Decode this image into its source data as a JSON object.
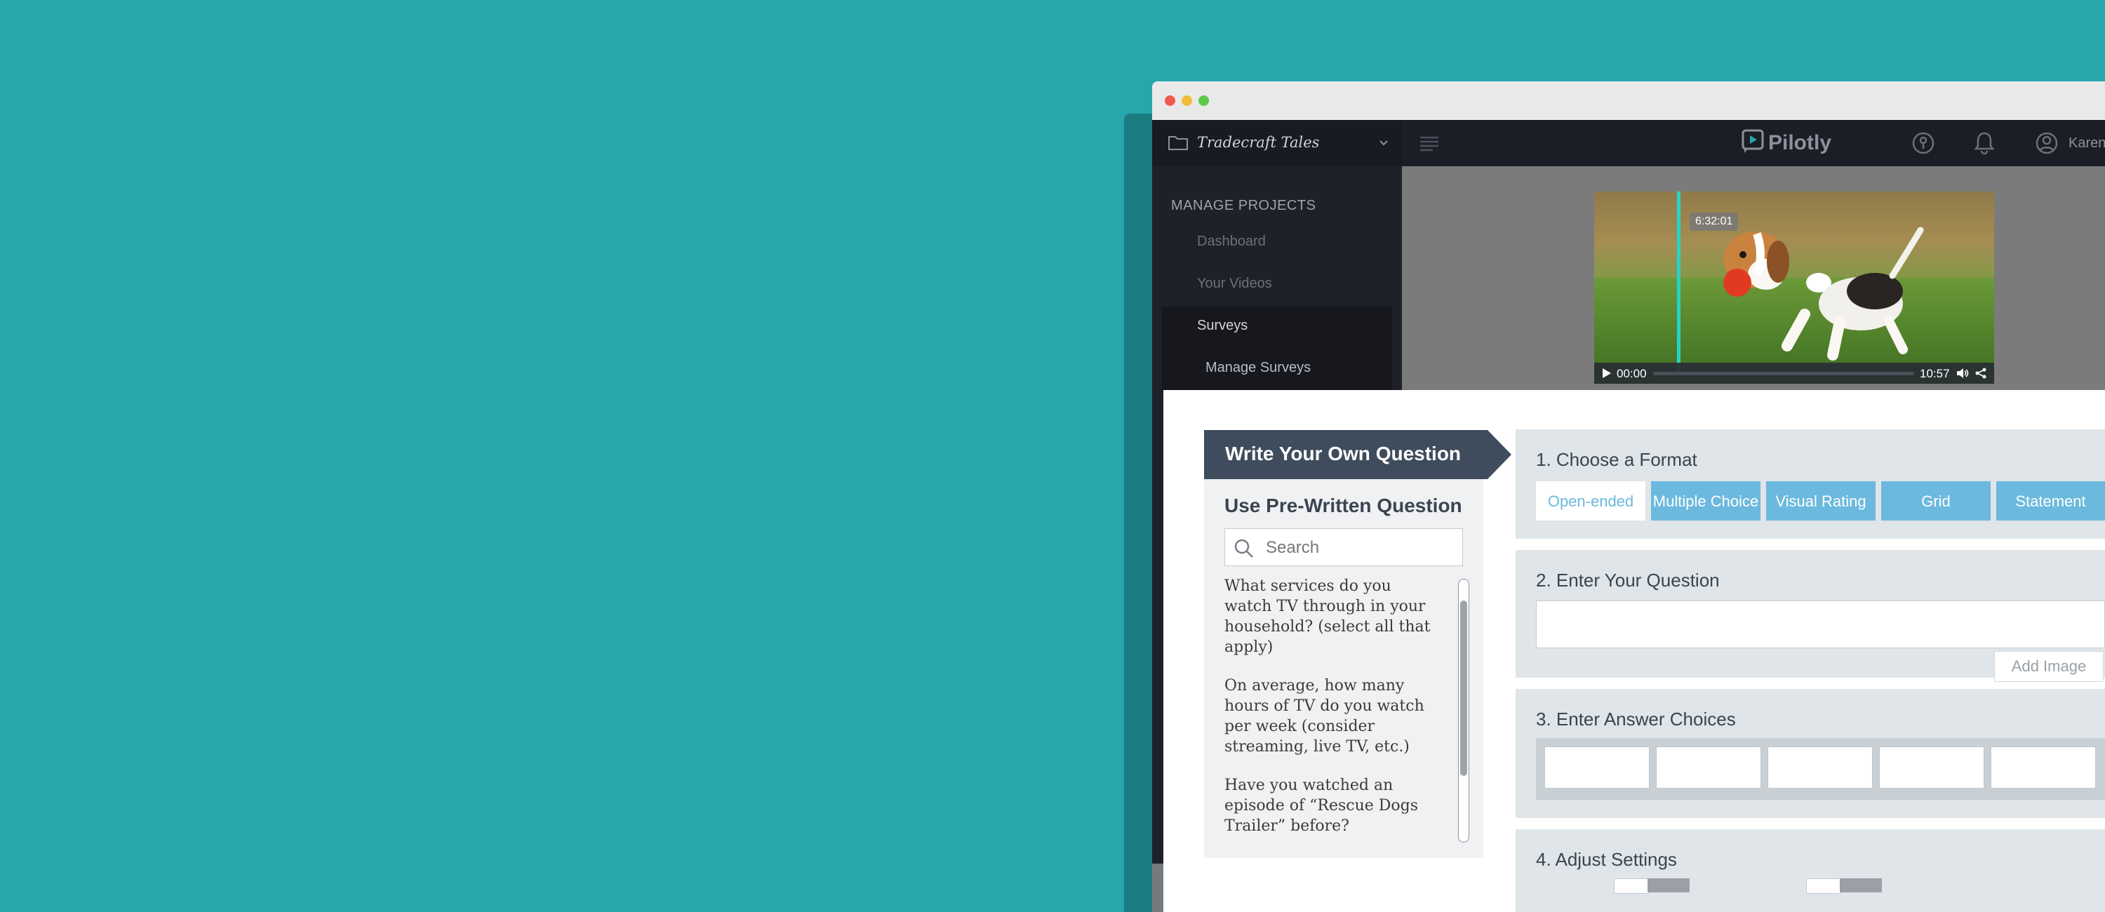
{
  "app": {
    "project_name": "Tradecraft Tales",
    "logo_text": "Pilotly",
    "user_name": "Karen"
  },
  "sidebar": {
    "section_title": "MANAGE PROJECTS",
    "items": [
      {
        "label": "Dashboard"
      },
      {
        "label": "Your Videos"
      },
      {
        "label": "Surveys"
      },
      {
        "label": "Manage Surveys"
      }
    ]
  },
  "video": {
    "marker_time": "6:32:01",
    "current_time": "00:00",
    "duration": "10:57",
    "progress": 0
  },
  "question_builder": {
    "write_own_label": "Write Your Own Question",
    "prewritten": {
      "title": "Use Pre-Written Question",
      "search_placeholder": "Search",
      "questions": [
        "What services do you watch TV through in your household? (select all that apply)",
        "On average, how many hours of TV do you watch per week (consider streaming, live TV, etc.)",
        "Have you watched an episode of “Rescue Dogs Trailer” before?"
      ]
    },
    "steps": {
      "format": {
        "title": "1. Choose a Format",
        "options": [
          "Open-ended",
          "Multiple Choice",
          "Visual Rating",
          "Grid",
          "Statement"
        ],
        "selected": "Open-ended"
      },
      "question": {
        "title": "2. Enter Your Question",
        "value": "",
        "add_image_label": "Add Image"
      },
      "answers": {
        "title": "3. Enter Answer Choices",
        "choices": [
          "",
          "",
          "",
          "",
          ""
        ]
      },
      "settings": {
        "title": "4. Adjust Settings"
      }
    }
  },
  "colors": {
    "background": "#27a6ac",
    "accent": "#6bb9de",
    "header": "#1b1e26",
    "marker": "#26d4c8"
  }
}
